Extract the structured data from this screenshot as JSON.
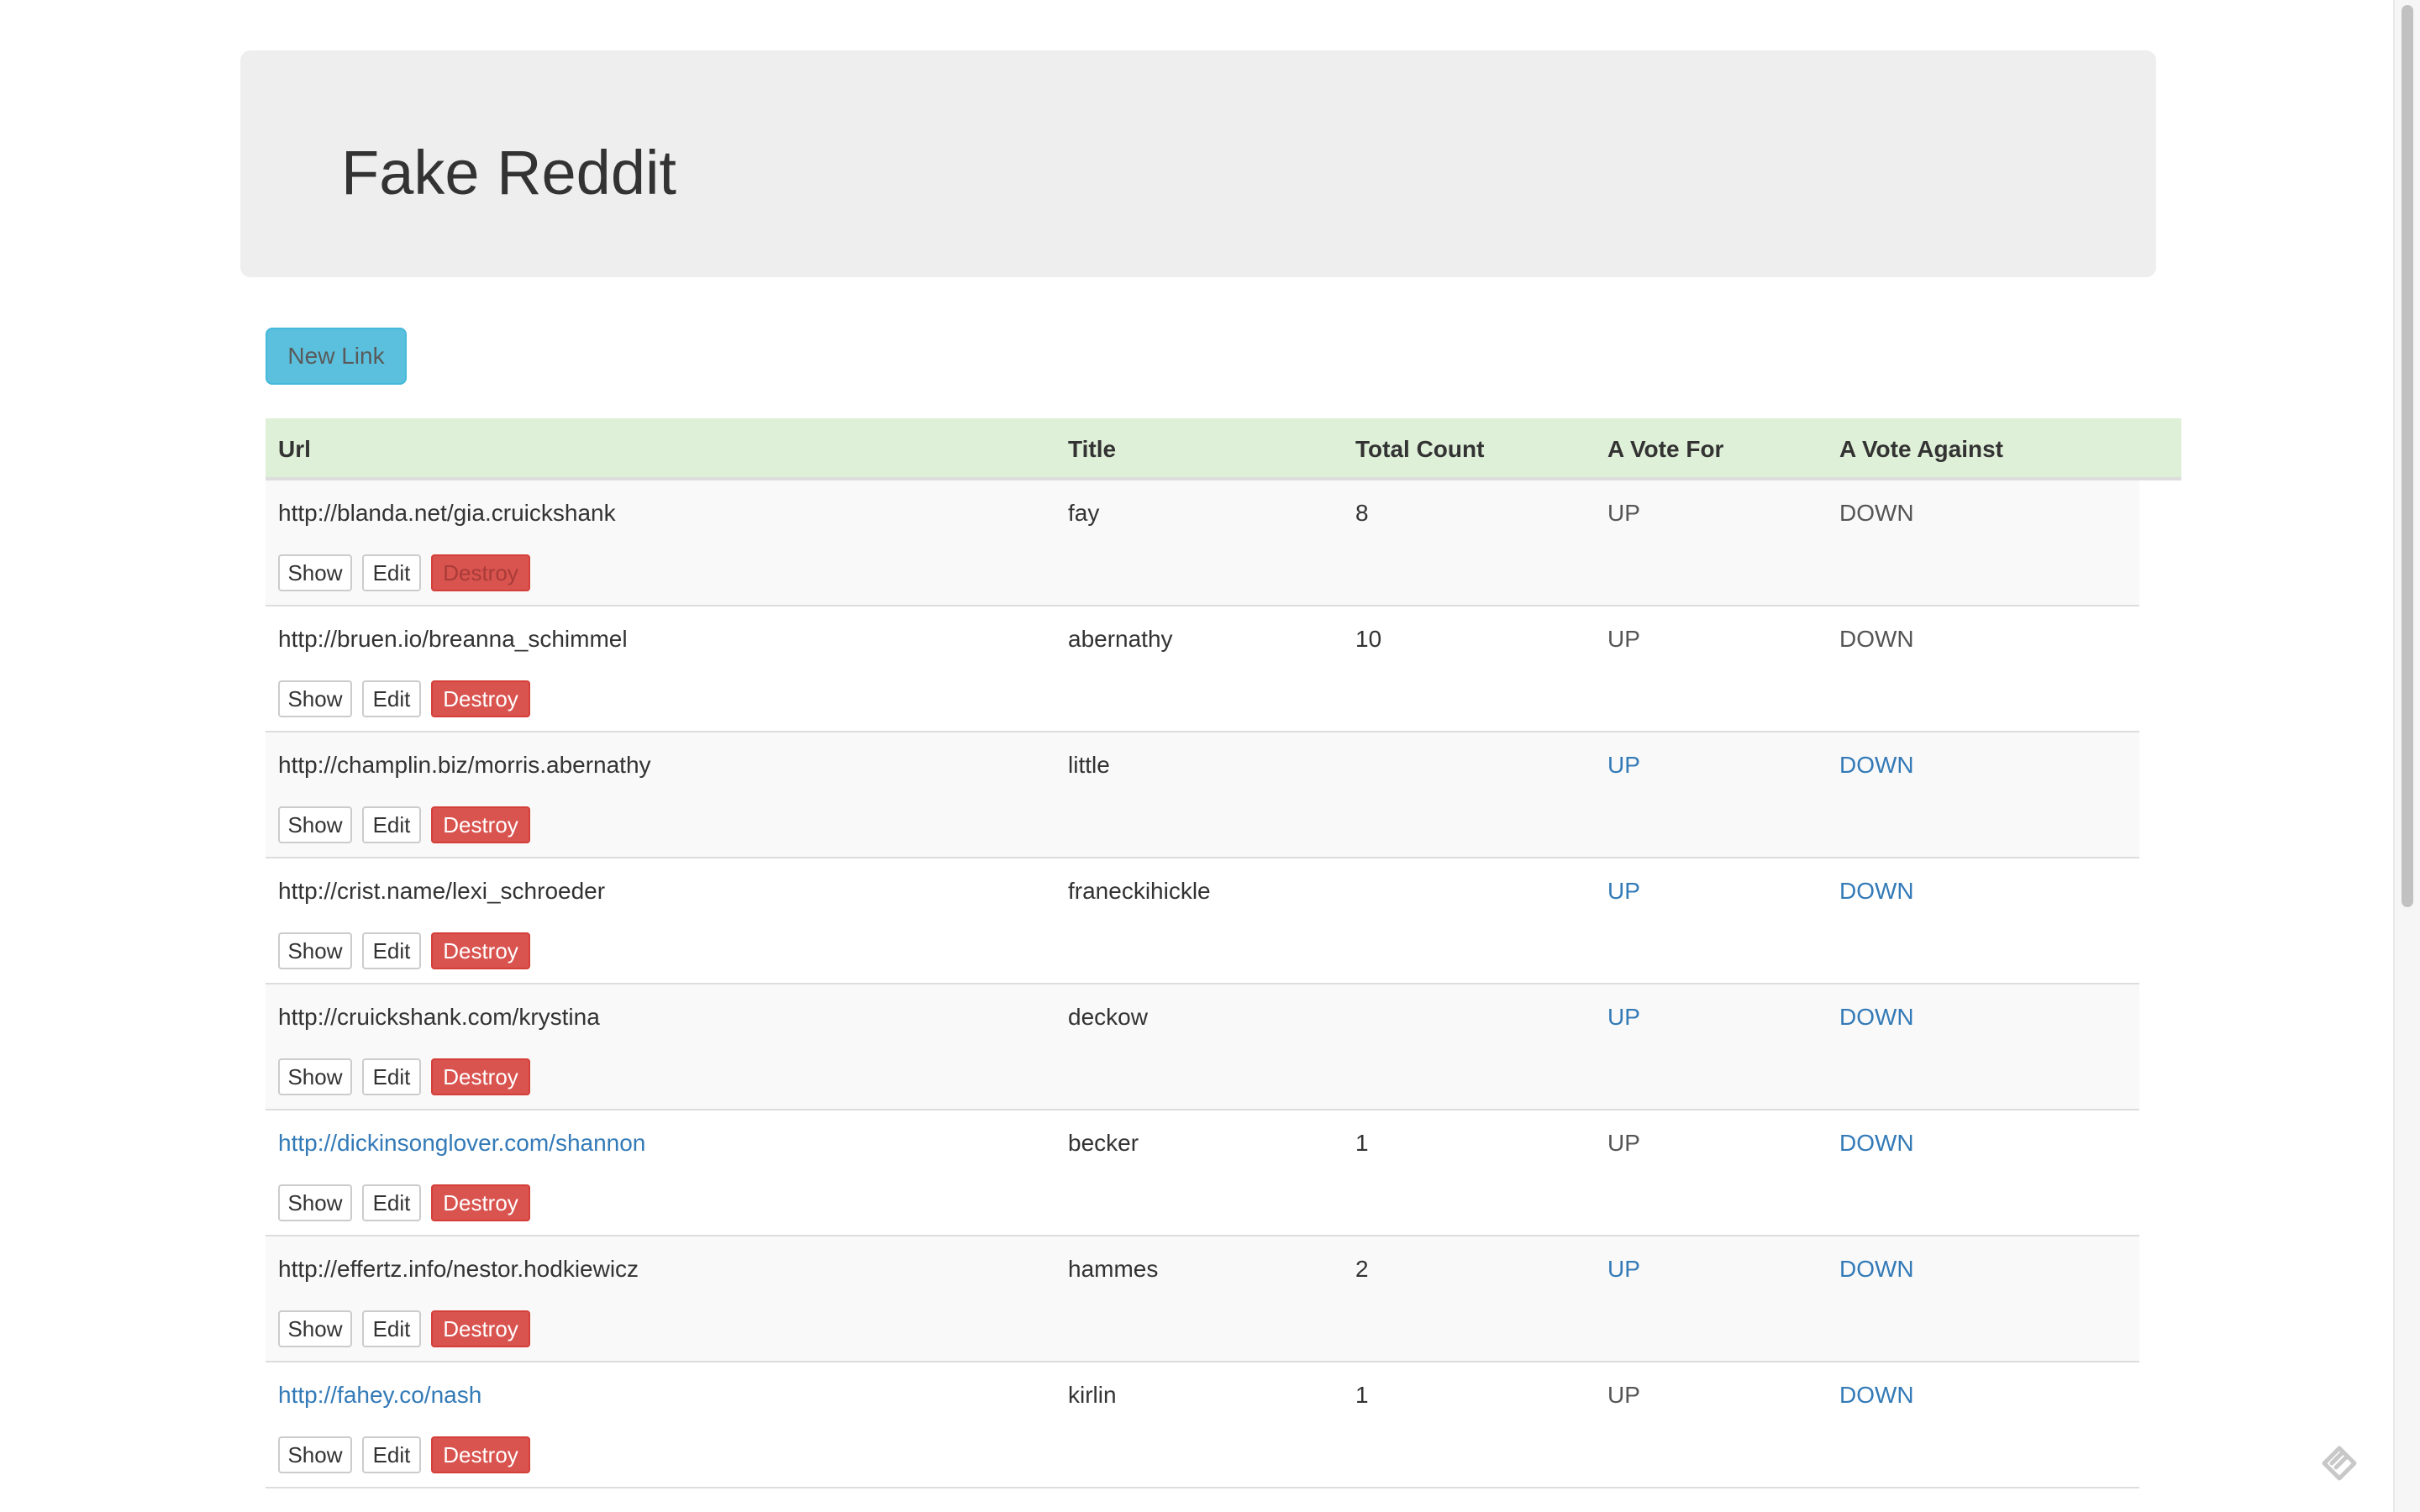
{
  "header": {
    "title": "Fake Reddit"
  },
  "toolbar": {
    "new_link_label": "New Link"
  },
  "table": {
    "columns": {
      "url": "Url",
      "title": "Title",
      "total_count": "Total Count",
      "vote_for": "A Vote For",
      "vote_against": "A Vote Against"
    },
    "actions": {
      "show": "Show",
      "edit": "Edit",
      "destroy": "Destroy"
    },
    "rows": [
      {
        "url": "http://blanda.net/gia.cruickshank",
        "title": "fay",
        "count": "8",
        "up": "UP",
        "down": "DOWN",
        "url_link": false,
        "up_link": false,
        "down_link": false
      },
      {
        "url": "http://bruen.io/breanna_schimmel",
        "title": "abernathy",
        "count": "10",
        "up": "UP",
        "down": "DOWN",
        "url_link": false,
        "up_link": false,
        "down_link": false
      },
      {
        "url": "http://champlin.biz/morris.abernathy",
        "title": "little",
        "count": "",
        "up": "UP",
        "down": "DOWN",
        "url_link": false,
        "up_link": true,
        "down_link": true
      },
      {
        "url": "http://crist.name/lexi_schroeder",
        "title": "franeckihickle",
        "count": "",
        "up": "UP",
        "down": "DOWN",
        "url_link": false,
        "up_link": true,
        "down_link": true
      },
      {
        "url": "http://cruickshank.com/krystina",
        "title": "deckow",
        "count": "",
        "up": "UP",
        "down": "DOWN",
        "url_link": false,
        "up_link": true,
        "down_link": true
      },
      {
        "url": "http://dickinsonglover.com/shannon",
        "title": "becker",
        "count": "1",
        "up": "UP",
        "down": "DOWN",
        "url_link": true,
        "up_link": false,
        "down_link": true
      },
      {
        "url": "http://effertz.info/nestor.hodkiewicz",
        "title": "hammes",
        "count": "2",
        "up": "UP",
        "down": "DOWN",
        "url_link": false,
        "up_link": true,
        "down_link": true
      },
      {
        "url": "http://fahey.co/nash",
        "title": "kirlin",
        "count": "1",
        "up": "UP",
        "down": "DOWN",
        "url_link": true,
        "up_link": false,
        "down_link": true
      }
    ]
  },
  "icons": {
    "corner": "pencil-icon"
  },
  "colors": {
    "link": "#337ab7",
    "header_row": "#dff0d8",
    "info_button": "#5bc0de",
    "danger_button": "#d9534f"
  }
}
